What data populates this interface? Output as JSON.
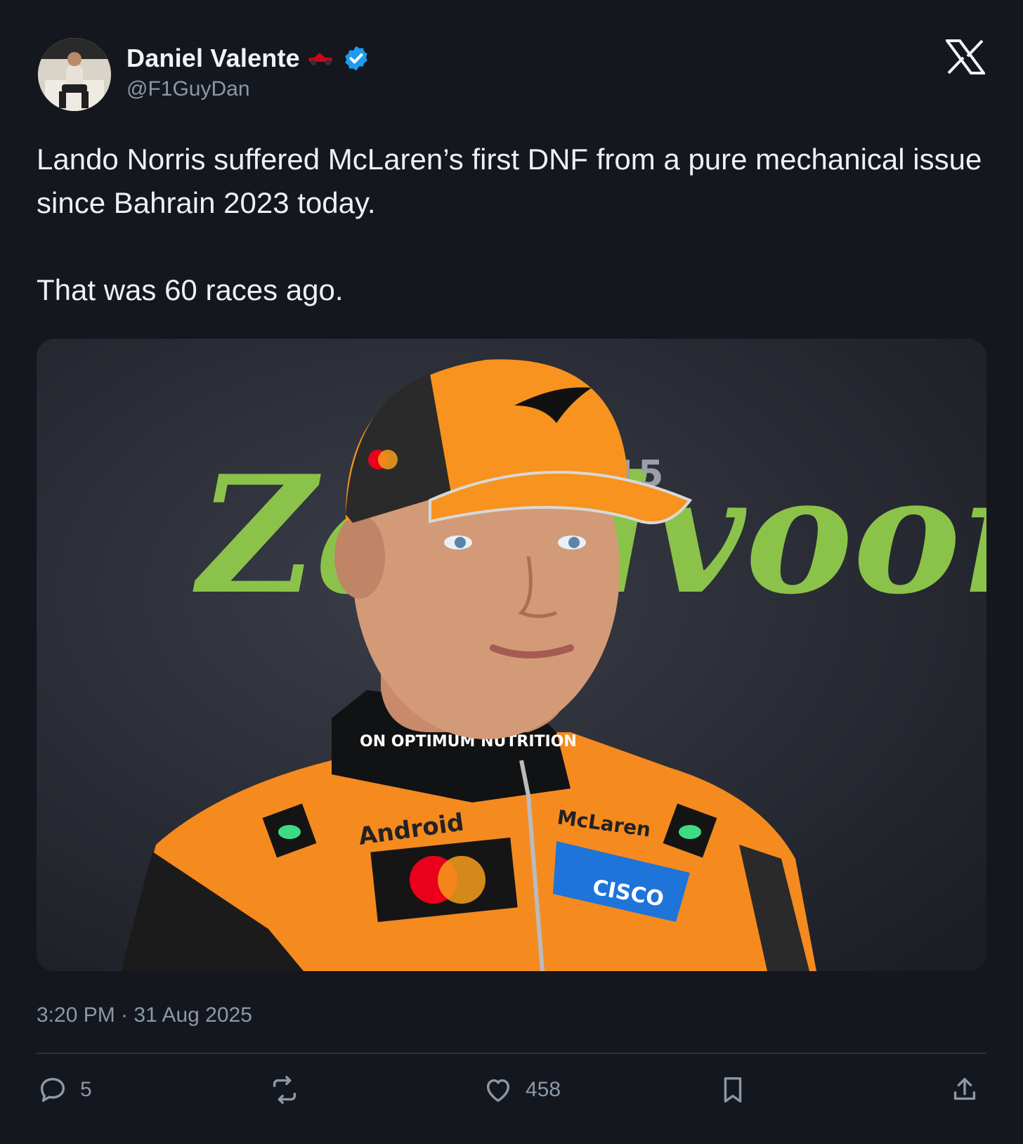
{
  "author": {
    "name": "Daniel Valente",
    "handle": "@F1GuyDan",
    "name_emoji_icon": "race-car-icon",
    "verified_icon": "verified-badge-icon"
  },
  "platform_icon": "x-logo-icon",
  "tweet": {
    "paragraphs": [
      "Lando Norris suffered McLaren’s first DNF from a pure mechanical issue since Bahrain 2023 today.",
      "That was 60 races ago."
    ]
  },
  "media": {
    "backdrop_text": "Zandvoort",
    "backdrop_number": "15",
    "suit_sponsors": [
      "ON OPTIMUM NUTRITION",
      "Android",
      "McLaren",
      "CISCO"
    ]
  },
  "meta": {
    "timestamp": "3:20 PM · 31 Aug 2025"
  },
  "actions": {
    "reply_count": "5",
    "repost_count": "",
    "like_count": "458"
  },
  "colors": {
    "background": "#15171f",
    "text_primary": "#eef0f2",
    "text_secondary": "#8b98a5",
    "verified_blue": "#1d9bf0",
    "papaya_orange": "#f7931e",
    "backdrop_green": "#8bc34a"
  }
}
